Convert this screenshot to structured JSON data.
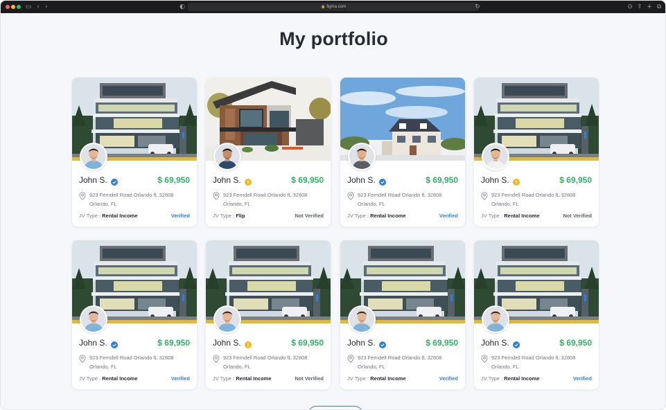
{
  "browser": {
    "url": "figma.com"
  },
  "page": {
    "title": "My portfolio"
  },
  "colors": {
    "price": "#2eb263",
    "verified_text": "#2f80d8",
    "verified_badge": "#2f80d8",
    "pending_badge": "#f5b71e",
    "not_verified_text": "#5b616c"
  },
  "cards": [
    {
      "name": "John S.",
      "badge": "verified-badge",
      "price": "$ 69,950",
      "address_line1": "923 Ferndell Road Orlando fL 32808",
      "address_line2": "Orlando, FL",
      "jv_label": "JV Type :",
      "jv_type": "Rental Income",
      "status": "Verified",
      "photo": "modern-building",
      "avatar": "man-1"
    },
    {
      "name": "John S.",
      "badge": "pending-badge",
      "price": "$ 69,950",
      "address_line1": "923 Ferndell Road Orlando fL 32808",
      "address_line2": "Orlando, FL",
      "jv_label": "JV Type :",
      "jv_type": "Flip",
      "status": "Not Verified",
      "photo": "modern-house",
      "avatar": "man-2"
    },
    {
      "name": "John S.",
      "badge": "verified-badge",
      "price": "$ 69,950",
      "address_line1": "923 Ferndell Road Orlando fL 32808",
      "address_line2": "Orlando, FL",
      "jv_label": "JV Type :",
      "jv_type": "Rental Income",
      "status": "Verified",
      "photo": "suburban-house",
      "avatar": "man-3"
    },
    {
      "name": "John S.",
      "badge": "pending-badge",
      "price": "$ 69,950",
      "address_line1": "923 Ferndell Road Orlando fL 32808",
      "address_line2": "Orlando, FL",
      "jv_label": "JV Type :",
      "jv_type": "Rental Income",
      "status": "Not Verified",
      "photo": "modern-building",
      "avatar": "man-4"
    },
    {
      "name": "John S.",
      "badge": "verified-badge",
      "price": "$ 69,950",
      "address_line1": "923 Ferndell Road Orlando fL 32808",
      "address_line2": "Orlando, FL",
      "jv_label": "JV Type :",
      "jv_type": "Rental Income",
      "status": "Verified",
      "photo": "modern-building",
      "avatar": "man-1"
    },
    {
      "name": "John S.",
      "badge": "pending-badge",
      "price": "$ 69,950",
      "address_line1": "923 Ferndell Road Orlando fL 32808",
      "address_line2": "Orlando, FL",
      "jv_label": "JV Type :",
      "jv_type": "Rental Income",
      "status": "Not Verified",
      "photo": "modern-building",
      "avatar": "man-1"
    },
    {
      "name": "John S.",
      "badge": "verified-badge",
      "price": "$ 69,950",
      "address_line1": "923 Ferndell Road Orlando fL 32808",
      "address_line2": "Orlando, FL",
      "jv_label": "JV Type :",
      "jv_type": "Rental Income",
      "status": "Verified",
      "photo": "modern-building",
      "avatar": "man-1"
    },
    {
      "name": "John S.",
      "badge": "verified-badge",
      "price": "$ 69,950",
      "address_line1": "923 Ferndell Road Orlando fL 32808",
      "address_line2": "Orlando, FL",
      "jv_label": "JV Type :",
      "jv_type": "Rental Income",
      "status": "Verified",
      "photo": "modern-building",
      "avatar": "man-1"
    }
  ]
}
